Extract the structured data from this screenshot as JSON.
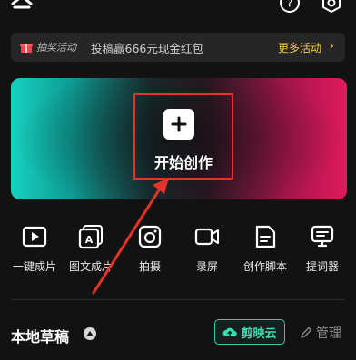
{
  "promo": {
    "tag": "抽奖活动",
    "text": "投稿赢666元现金红包",
    "more": "更多活动",
    "arrow": "›"
  },
  "banner": {
    "label": "开始创作"
  },
  "tools": [
    {
      "label": "一键成片",
      "icon": "play-icon"
    },
    {
      "label": "图文成片",
      "icon": "text-to-video-icon"
    },
    {
      "label": "拍摄",
      "icon": "camera-icon"
    },
    {
      "label": "录屏",
      "icon": "screen-record-icon"
    },
    {
      "label": "创作脚本",
      "icon": "script-icon"
    },
    {
      "label": "提词器",
      "icon": "teleprompter-icon"
    }
  ],
  "drafts": {
    "title": "本地草稿",
    "cloud_label": "剪映云",
    "manage_label": "管理"
  },
  "colors": {
    "accent_teal": "#2fcfa3",
    "promo_link": "#f4c84a",
    "annotation_red": "#e5332a"
  }
}
